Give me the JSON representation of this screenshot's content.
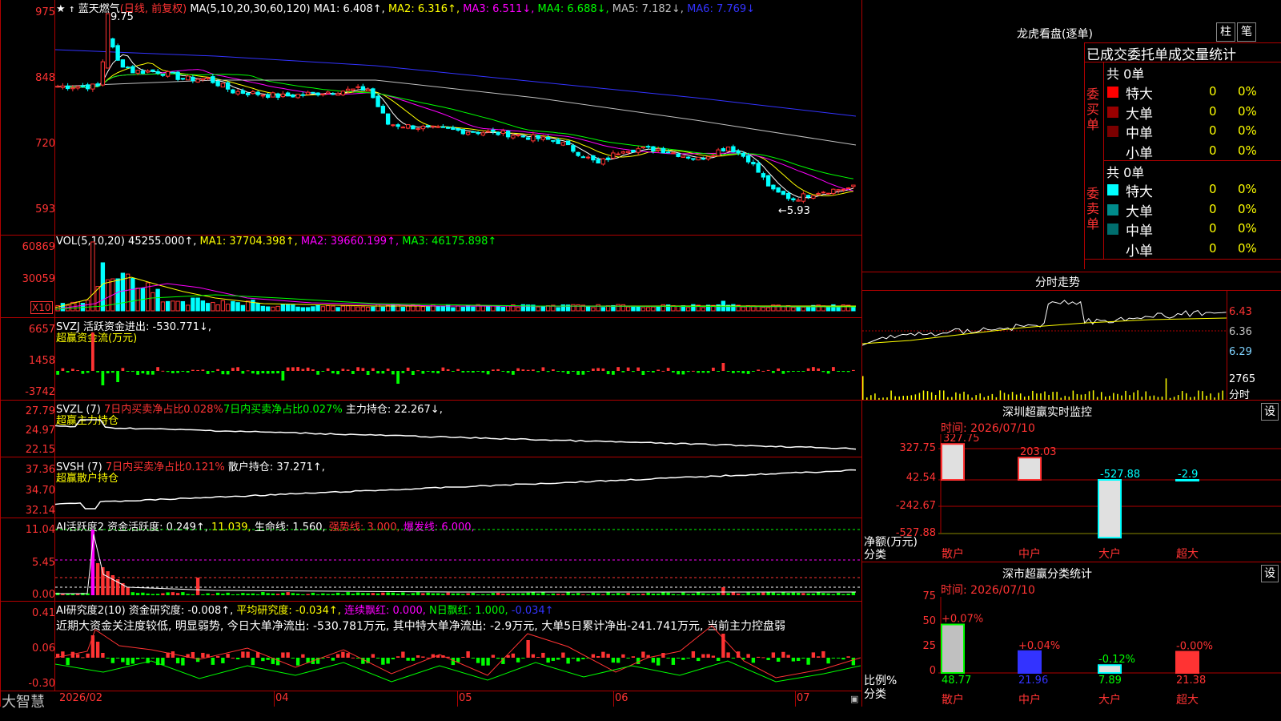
{
  "stock": {
    "title": "蓝天燃气",
    "period": "(日线, 前复权)",
    "ma_legend": {
      "label": "MA(5,10,20,30,60,120)",
      "ma1": "MA1: 6.408↑,",
      "ma2": "MA2: 6.316↑,",
      "ma3": "MA3: 6.511↓,",
      "ma4": "MA4: 6.688↓,",
      "ma5": "MA5: 7.182↓,",
      "ma6": "MA6: 7.769↓"
    },
    "y_labels": [
      "975",
      "848",
      "720",
      "593"
    ],
    "high_note": "9.75",
    "low_note": "←5.93"
  },
  "volume": {
    "legend_label": "VOL(5,10,20)",
    "value": "45255.000↑,",
    "ma1": "MA1: 37704.398↑,",
    "ma2": "MA2: 39660.199↑,",
    "ma3": "MA3: 46175.898↑",
    "y_labels": [
      "60869",
      "30059"
    ],
    "x10": "X10"
  },
  "svzj": {
    "legend1": "SVZJ  活跃资金进出: -530.771↓,",
    "legend2": "超赢资金流(万元)",
    "y_labels": [
      "6657",
      "1458",
      "-3742"
    ]
  },
  "svzl": {
    "name": "SVZL (7)",
    "ratio1": "7日内买卖净占比0.028%",
    "ratio2": "7日内买卖净占比0.027%",
    "main": "主力持仓: 22.267↓,",
    "sub": "超赢主力持仓",
    "y_labels": [
      "27.79",
      "24.97",
      "22.15"
    ]
  },
  "svsh": {
    "name": "SVSH (7)",
    "ratio1": "7日内买卖净占比0.121%",
    "retail": "散户持仓: 37.271↑,",
    "sub": "超赢散户持仓",
    "y_labels": [
      "37.36",
      "34.70",
      "32.14"
    ]
  },
  "ai_active": {
    "name": "AI活跃度2",
    "v1": "资金活跃度: 0.249↑,",
    "v2": "11.039,",
    "v3": "生命线: 1.560,",
    "v4": "强势线: 3.000,",
    "v5": "爆发线: 6.000,",
    "y_labels": [
      "11.04",
      "5.45",
      "0.00"
    ]
  },
  "ai_research": {
    "name": "AI研究度2(10)",
    "v1": "资金研究度: -0.008↑,",
    "v2": "平均研究度: -0.034↑,",
    "v3": "连续飘红: 0.000,",
    "v4": "N日飘红: 1.000,",
    "v5": "-0.034↑",
    "comment": "近期大资金关注度较低, 明显弱势, 今日大单净流出: -530.781万元, 其中特大单净流出: -2.9万元, 大单5日累计净出-241.741万元, 当前主力控盘弱",
    "y_labels": [
      "0.41",
      "0.06",
      "-0.30"
    ]
  },
  "xaxis": {
    "labels": [
      "2026/02",
      "04",
      "05",
      "06",
      "07"
    ]
  },
  "brand": "大智慧",
  "right": {
    "dragon_title": "龙虎看盘(逐单)",
    "btn_bar": "柱",
    "btn_pen": "笔",
    "stats_title": "已成交委托单成交量统计",
    "buy_label": "委买单",
    "sell_label": "委卖单",
    "buy_total": "共 0单",
    "sell_total": "共 0单",
    "buy_rows": [
      {
        "label": "特大",
        "count": "0",
        "pct": "0%",
        "color": "#ff0000"
      },
      {
        "label": "大单",
        "count": "0",
        "pct": "0%",
        "color": "#990000"
      },
      {
        "label": "中单",
        "count": "0",
        "pct": "0%",
        "color": "#7a0000"
      },
      {
        "label": "小单",
        "count": "0",
        "pct": "0%",
        "color": "#000000"
      }
    ],
    "sell_rows": [
      {
        "label": "特大",
        "count": "0",
        "pct": "0%",
        "color": "#00ffff"
      },
      {
        "label": "大单",
        "count": "0",
        "pct": "0%",
        "color": "#008c8c"
      },
      {
        "label": "中单",
        "count": "0",
        "pct": "0%",
        "color": "#006e6e"
      },
      {
        "label": "小单",
        "count": "0",
        "pct": "0%",
        "color": "#000000"
      }
    ],
    "intraday_title": "分时走势",
    "intraday_prices": [
      "6.43",
      "6.36",
      "6.29"
    ],
    "intraday_vol": "2765",
    "intraday_unit": "分时",
    "monitor_title": "深圳超赢实时监控",
    "monitor_btn": "设",
    "monitor_time": "时间: 2026/07/10",
    "monitor_y": [
      "327.75",
      "42.54",
      "-242.67",
      "-527.88"
    ],
    "monitor_values": [
      "327.75",
      "203.03",
      "-527.88",
      "-2.9"
    ],
    "monitor_ylabel1": "净额(万元)",
    "monitor_ylabel2": "分类",
    "monitor_cats": [
      "散户",
      "中户",
      "大户",
      "超大"
    ],
    "class_title": "深市超赢分类统计",
    "class_btn": "设",
    "class_time": "时间: 2026/07/10",
    "class_y": [
      "75",
      "50",
      "25",
      "0"
    ],
    "class_pct": [
      "+0.07%",
      "+0.04%",
      "-0.12%",
      "-0.00%"
    ],
    "class_vals": [
      "48.77",
      "21.96",
      "7.89",
      "21.38"
    ],
    "class_ylabel1": "比例%",
    "class_ylabel2": "分类",
    "class_cats": [
      "散户",
      "中户",
      "大户",
      "超大"
    ]
  },
  "colors": {
    "up": "#ff3333",
    "down": "#00ffff",
    "ma1": "#ffffff",
    "ma2": "#ffff00",
    "ma3": "#ff00ff",
    "ma4": "#00ff00",
    "ma5": "#c0c0c0",
    "ma6": "#3333ff"
  }
}
